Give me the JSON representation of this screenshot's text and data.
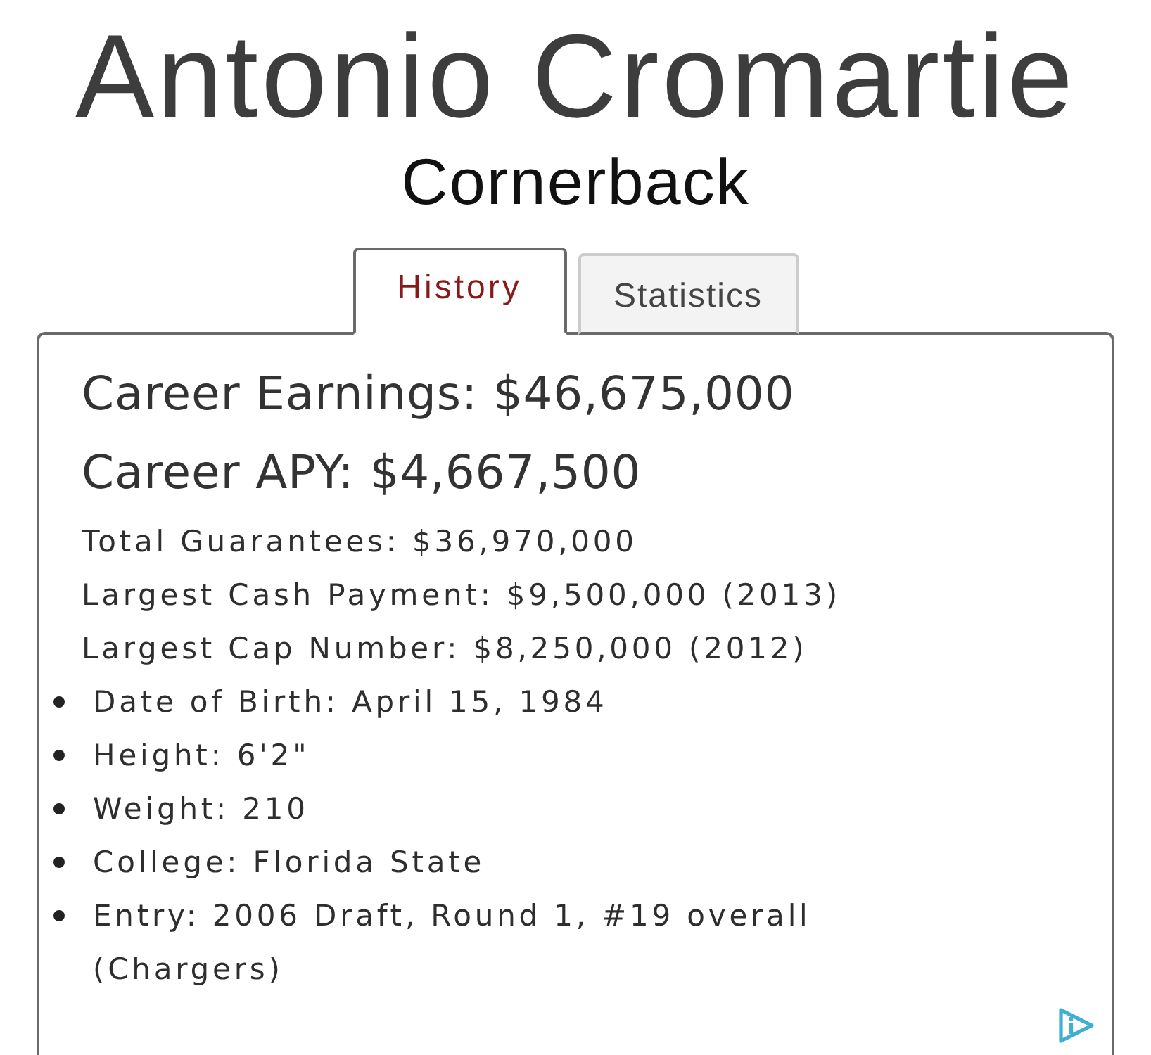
{
  "header": {
    "name": "Antonio Cromartie",
    "position": "Cornerback"
  },
  "tabs": [
    {
      "label": "History",
      "selected": true
    },
    {
      "label": "Statistics",
      "selected": false
    }
  ],
  "panel": {
    "headline_stats": [
      "Career Earnings: $46,675,000",
      "Career APY: $4,667,500"
    ],
    "contract_stats": [
      "Total Guarantees: $36,970,000",
      "Largest Cash Payment: $9,500,000 (2013)",
      "Largest Cap Number: $8,250,000 (2012)"
    ],
    "bio": [
      "Date of Birth: April 15, 1984",
      "Height: 6'2\"",
      "Weight: 210",
      "College: Florida State",
      "Entry: 2006 Draft, Round 1, #19 overall (Chargers)"
    ]
  }
}
